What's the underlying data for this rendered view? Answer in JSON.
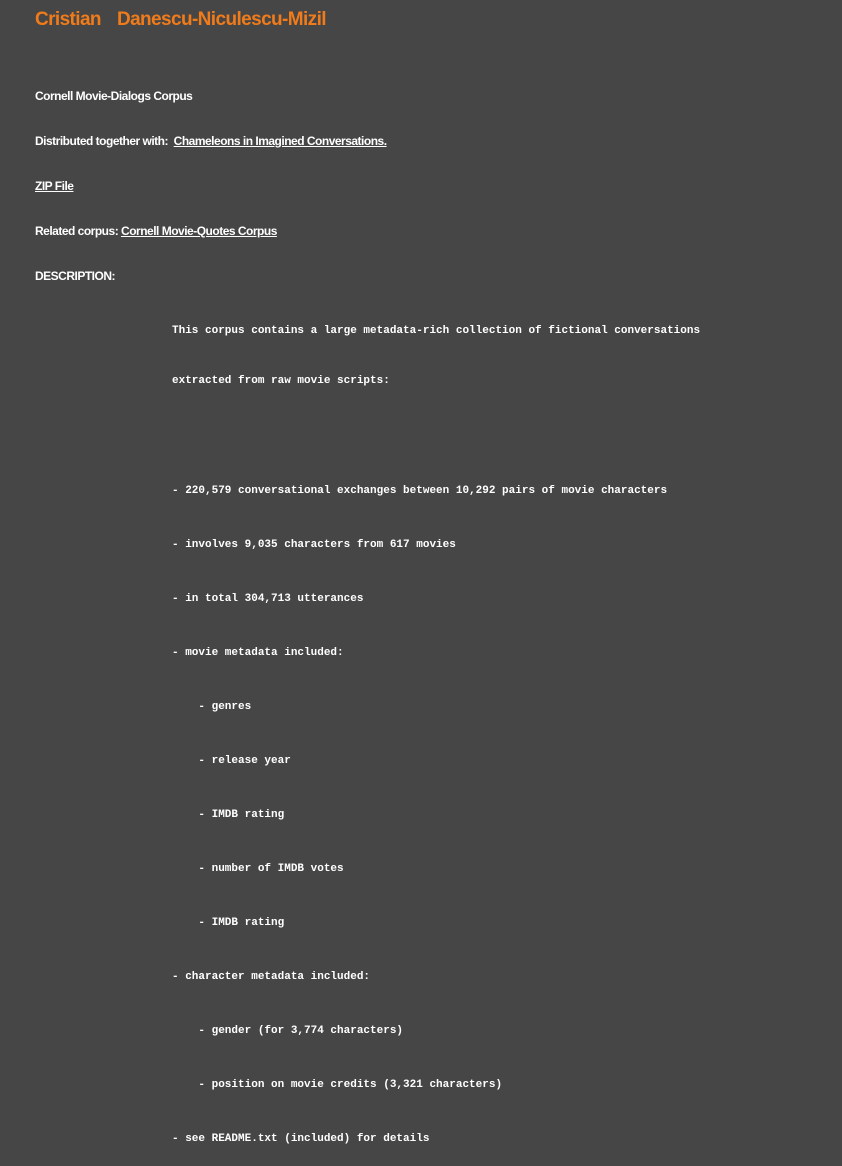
{
  "header": {
    "first_name": "Cristian",
    "last_name": "Danescu-Niculescu-Mizil"
  },
  "corpus_title": "Cornell Movie-Dialogs Corpus",
  "distributed": {
    "label": "Distributed together with:",
    "link_text": "Chameleons in Imagined Conversations."
  },
  "zip_link": "ZIP File",
  "related": {
    "label": "Related corpus:",
    "link_text": "Cornell Movie-Quotes Corpus"
  },
  "description": {
    "heading": "DESCRIPTION:",
    "intro": [
      "This corpus contains a large metadata-rich collection of fictional conversations",
      "extracted from raw movie scripts:"
    ],
    "items": [
      "- 220,579 conversational exchanges between 10,292 pairs of movie characters",
      "- involves 9,035 characters from 617 movies",
      "- in total 304,713 utterances",
      "- movie metadata included:",
      "    - genres",
      "    - release year",
      "    - IMDB rating",
      "    - number of IMDB votes",
      "    - IMDB rating",
      "- character metadata included:",
      "    - gender (for 3,774 characters)",
      "    - position on movie credits (3,321 characters)",
      "- see README.txt (included) for details"
    ]
  },
  "colors": {
    "background": "#464646",
    "accent": "#f07b1a",
    "text": "#ffffff"
  }
}
